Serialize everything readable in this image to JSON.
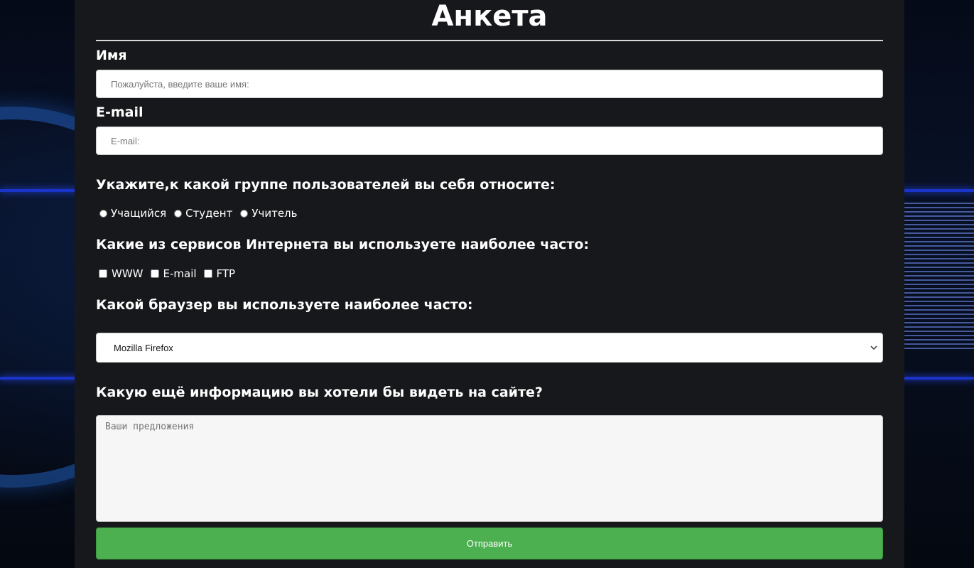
{
  "form": {
    "title": "Анкета",
    "name": {
      "label": "Имя",
      "placeholder": "Пожалуйста, введите ваше имя:"
    },
    "email": {
      "label": "E-mail",
      "placeholder": "E-mail:"
    },
    "group": {
      "question": "Укажите,к какой группе пользователей вы себя относите:",
      "options": [
        "Учащийся",
        "Студент",
        "Учитель"
      ]
    },
    "services": {
      "question": "Какие из сервисов Интернета вы используете наиболее часто:",
      "options": [
        "WWW",
        "E-mail",
        "FTP"
      ]
    },
    "browser": {
      "question": "Какой браузер вы используете наиболее часто:",
      "selected": "Mozilla Firefox"
    },
    "suggestions": {
      "question": "Какую ещё информацию вы хотели бы видеть на сайте?",
      "placeholder": "Ваши предложения"
    },
    "submit_label": "Отправить"
  },
  "colors": {
    "panel": "#17181b",
    "submit": "#4caf50",
    "accent_band": "#1a33c9"
  }
}
